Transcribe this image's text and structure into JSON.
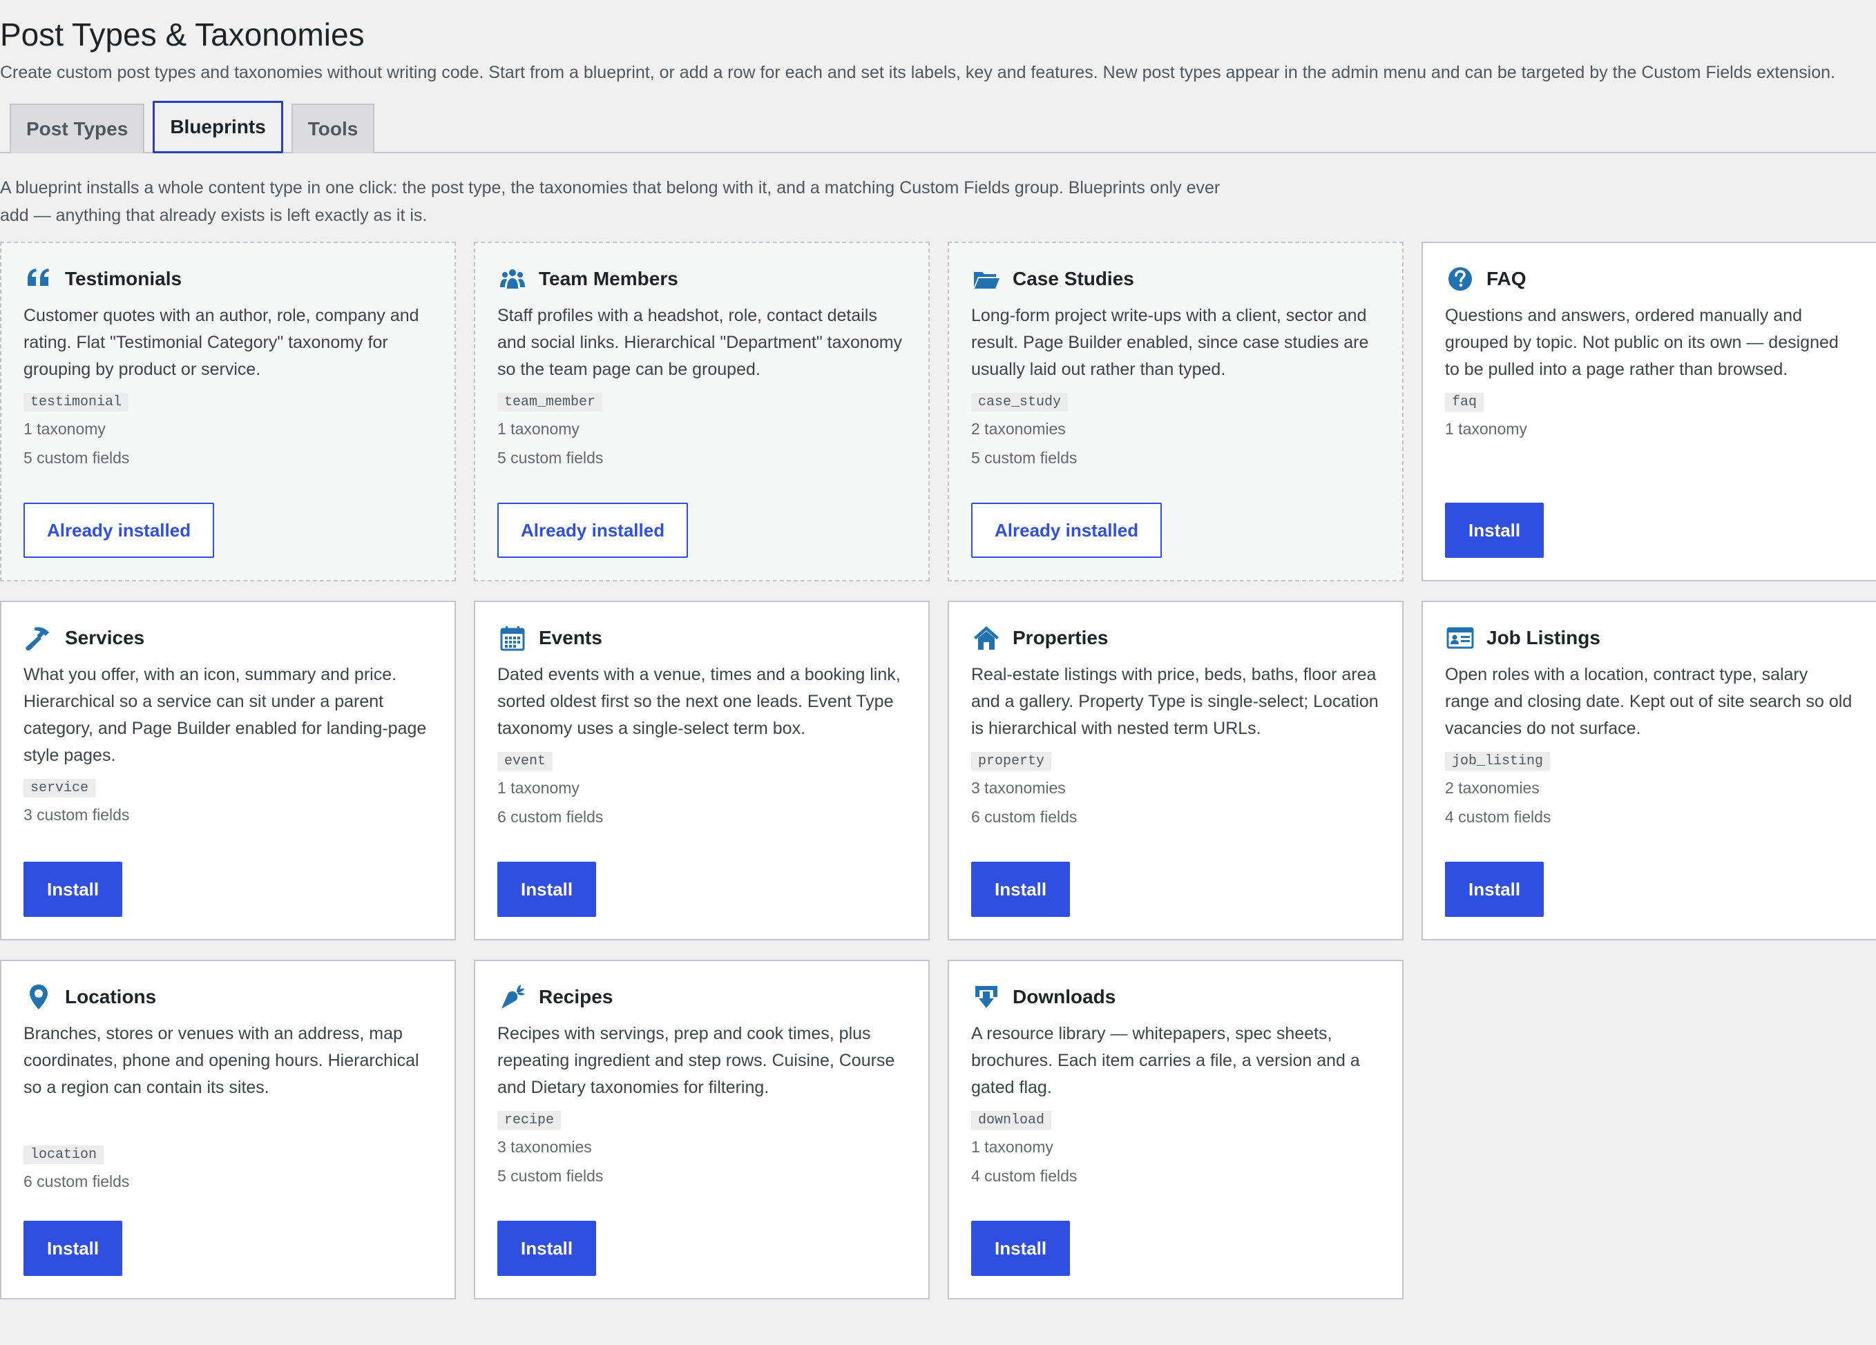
{
  "page": {
    "title": "Post Types & Taxonomies",
    "description": "Create custom post types and taxonomies without writing code. Start from a blueprint, or add a row for each and set its labels, key and features. New post types appear in the admin menu and can be targeted by the Custom Fields extension."
  },
  "tabs": [
    {
      "label": "Post Types",
      "active": false
    },
    {
      "label": "Blueprints",
      "active": true
    },
    {
      "label": "Tools",
      "active": false
    }
  ],
  "intro": "A blueprint installs a whole content type in one click: the post type, the taxonomies that belong with it, and a matching Custom Fields group. Blueprints only ever add — anything that already exists is left exactly as it is.",
  "colors": {
    "primary": "#2f4fe0",
    "icon": "#2271b1",
    "background": "#f0f0f1"
  },
  "cards": [
    {
      "icon": "quote-icon",
      "title": "Testimonials",
      "description": "Customer quotes with an author, role, company and rating. Flat \"Testimonial Category\" taxonomy for grouping by product or service.",
      "slug": "testimonial",
      "taxonomies": "1 taxonomy",
      "fields": "5 custom fields",
      "button": "Already installed",
      "installed": true
    },
    {
      "icon": "team-icon",
      "title": "Team Members",
      "description": "Staff profiles with a headshot, role, contact details and social links. Hierarchical \"Department\" taxonomy so the team page can be grouped.",
      "slug": "team_member",
      "taxonomies": "1 taxonomy",
      "fields": "5 custom fields",
      "button": "Already installed",
      "installed": true
    },
    {
      "icon": "folder-icon",
      "title": "Case Studies",
      "description": "Long-form project write-ups with a client, sector and result. Page Builder enabled, since case studies are usually laid out rather than typed.",
      "slug": "case_study",
      "taxonomies": "2 taxonomies",
      "fields": "5 custom fields",
      "button": "Already installed",
      "installed": true
    },
    {
      "icon": "question-icon",
      "title": "FAQ",
      "description": "Questions and answers, ordered manually and grouped by topic. Not public on its own — designed to be pulled into a page rather than browsed.",
      "slug": "faq",
      "taxonomies": "1 taxonomy",
      "fields": "",
      "button": "Install",
      "installed": false
    },
    {
      "icon": "hammer-icon",
      "title": "Services",
      "description": "What you offer, with an icon, summary and price. Hierarchical so a service can sit under a parent category, and Page Builder enabled for landing-page style pages.",
      "slug": "service",
      "taxonomies": "",
      "fields": "3 custom fields",
      "button": "Install",
      "installed": false
    },
    {
      "icon": "calendar-icon",
      "title": "Events",
      "description": "Dated events with a venue, times and a booking link, sorted oldest first so the next one leads. Event Type taxonomy uses a single-select term box.",
      "slug": "event",
      "taxonomies": "1 taxonomy",
      "fields": "6 custom fields",
      "button": "Install",
      "installed": false
    },
    {
      "icon": "house-icon",
      "title": "Properties",
      "description": "Real-estate listings with price, beds, baths, floor area and a gallery. Property Type is single-select; Location is hierarchical with nested term URLs.",
      "slug": "property",
      "taxonomies": "3 taxonomies",
      "fields": "6 custom fields",
      "button": "Install",
      "installed": false
    },
    {
      "icon": "id-card-icon",
      "title": "Job Listings",
      "description": "Open roles with a location, contract type, salary range and closing date. Kept out of site search so old vacancies do not surface.",
      "slug": "job_listing",
      "taxonomies": "2 taxonomies",
      "fields": "4 custom fields",
      "button": "Install",
      "installed": false
    },
    {
      "icon": "pin-icon",
      "title": "Locations",
      "description": "Branches, stores or venues with an address, map coordinates, phone and opening hours. Hierarchical so a region can contain its sites.",
      "slug": "location",
      "taxonomies": "",
      "fields": "6 custom fields",
      "button": "Install",
      "installed": false
    },
    {
      "icon": "carrot-icon",
      "title": "Recipes",
      "description": "Recipes with servings, prep and cook times, plus repeating ingredient and step rows. Cuisine, Course and Dietary taxonomies for filtering.",
      "slug": "recipe",
      "taxonomies": "3 taxonomies",
      "fields": "5 custom fields",
      "button": "Install",
      "installed": false
    },
    {
      "icon": "download-icon",
      "title": "Downloads",
      "description": "A resource library — whitepapers, spec sheets, brochures. Each item carries a file, a version and a gated flag.",
      "slug": "download",
      "taxonomies": "1 taxonomy",
      "fields": "4 custom fields",
      "button": "Install",
      "installed": false
    }
  ]
}
